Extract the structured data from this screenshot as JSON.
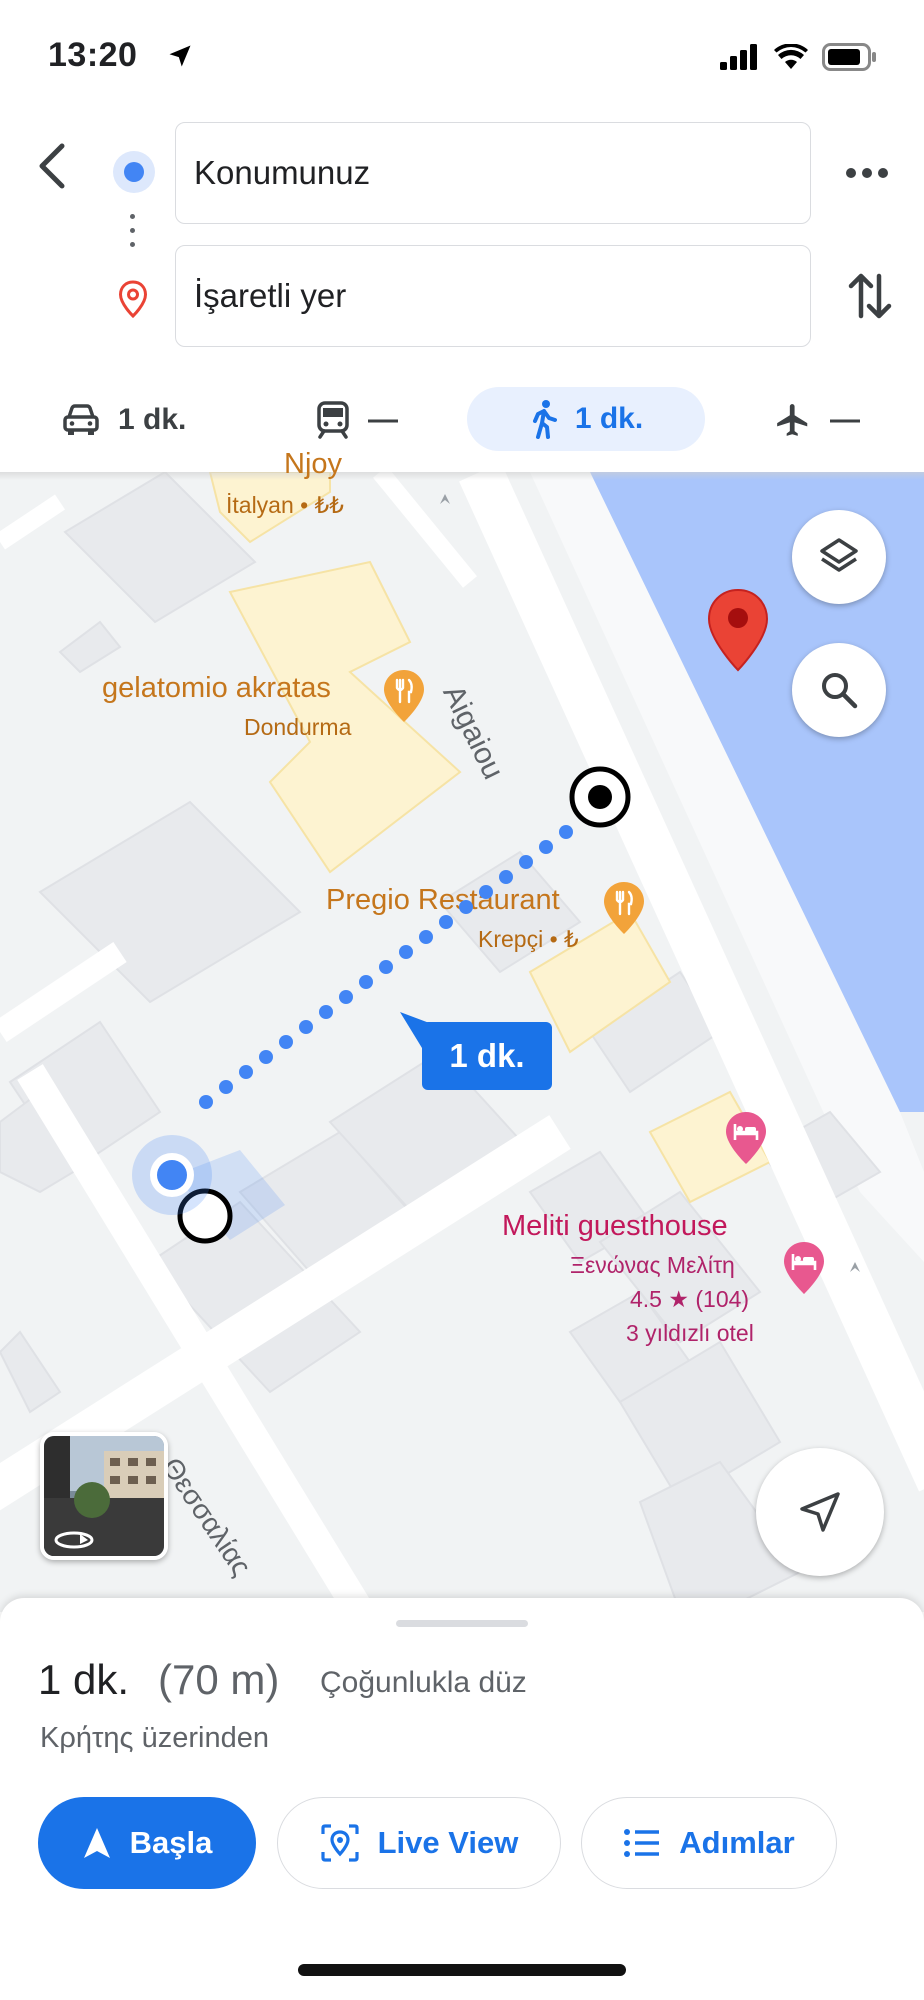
{
  "status_bar": {
    "time": "13:20"
  },
  "route_inputs": {
    "origin": "Konumunuz",
    "destination": "İşaretli yer"
  },
  "travel_modes": [
    {
      "mode": "car",
      "label": "1 dk."
    },
    {
      "mode": "transit",
      "label": "—"
    },
    {
      "mode": "walk",
      "label": "1 dk.",
      "selected": true
    },
    {
      "mode": "flight",
      "label": "—"
    }
  ],
  "map": {
    "pois": {
      "njoy": {
        "title": "Njoy",
        "subtitle": "İtalyan • ₺₺"
      },
      "gelatomio": {
        "title": "gelatomio akratas",
        "subtitle": "Dondurma"
      },
      "pregio": {
        "title": "Pregio Restaurant",
        "subtitle": "Krepçi • ₺"
      },
      "meliti": {
        "title": "Meliti guesthouse",
        "alt_name": "Ξενώνας Μελίτη",
        "rating": "4.5 ★ (104)",
        "type": "3 yıldızlı otel"
      }
    },
    "streets": {
      "aigaiou": "Aigaiou",
      "thessalias": "Θεσσαλίας"
    },
    "route_eta_badge": "1 dk.",
    "colors": {
      "route": "#4285f4",
      "water": "#a9c5fb",
      "dest_pin": "#ea4335",
      "poi_food": "#f2a33a",
      "poi_hotel": "#e8588f"
    }
  },
  "summary": {
    "time": "1 dk.",
    "distance": "(70 m)",
    "description": "Çoğunlukla düz",
    "via": "Κρήτης üzerinden"
  },
  "actions": {
    "start": "Başla",
    "live_view": "Live View",
    "steps": "Adımlar"
  }
}
